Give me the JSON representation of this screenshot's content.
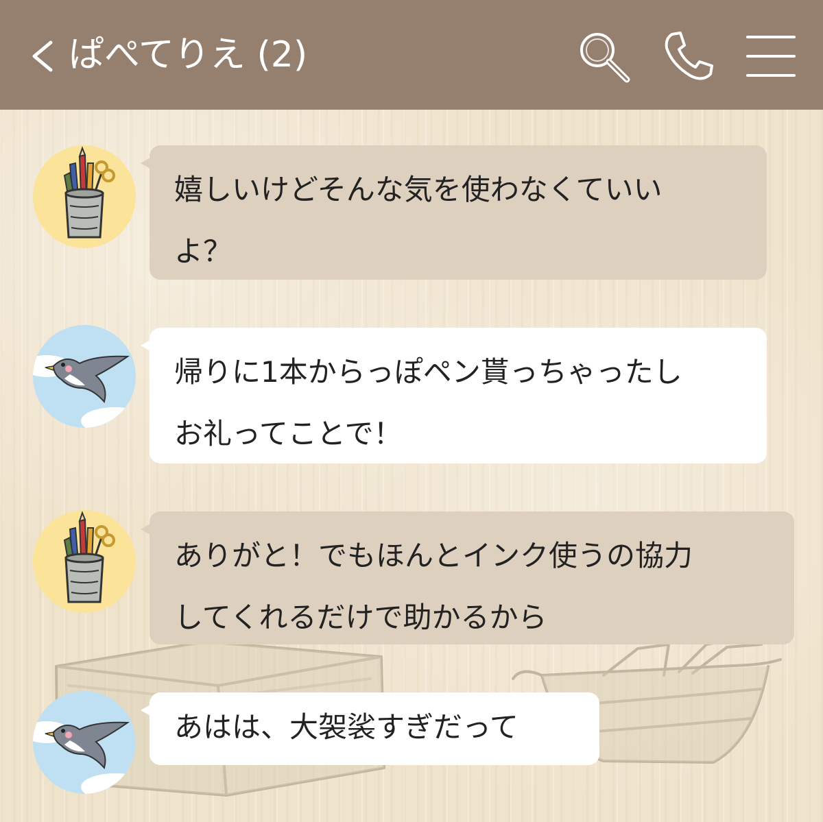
{
  "header": {
    "title": "ぱぺてりえ (2)",
    "icons": {
      "back": "chevron-left-icon",
      "search": "search-icon",
      "call": "phone-icon",
      "menu": "menu-icon"
    },
    "color": "#957f6e"
  },
  "messages": [
    {
      "sender_avatar": "pencil-cup-avatar",
      "lines": [
        "嬉しいけどそんな気を使わなくていい",
        "よ？"
      ],
      "bubble_color": "#ddd0bf"
    },
    {
      "sender_avatar": "swallow-avatar",
      "lines": [
        "帰りに1本からっぽペン貰っちゃったし",
        "お礼ってことで！"
      ],
      "bubble_color": "#ffffff"
    },
    {
      "sender_avatar": "pencil-cup-avatar",
      "lines": [
        "ありがと！でもほんとインク使うの協力",
        "してくれるだけで助かるから"
      ],
      "bubble_color": "#ddd0bf"
    },
    {
      "sender_avatar": "swallow-avatar",
      "lines": [
        "あはは、大袈裟すぎだって"
      ],
      "bubble_color": "#ffffff"
    }
  ]
}
